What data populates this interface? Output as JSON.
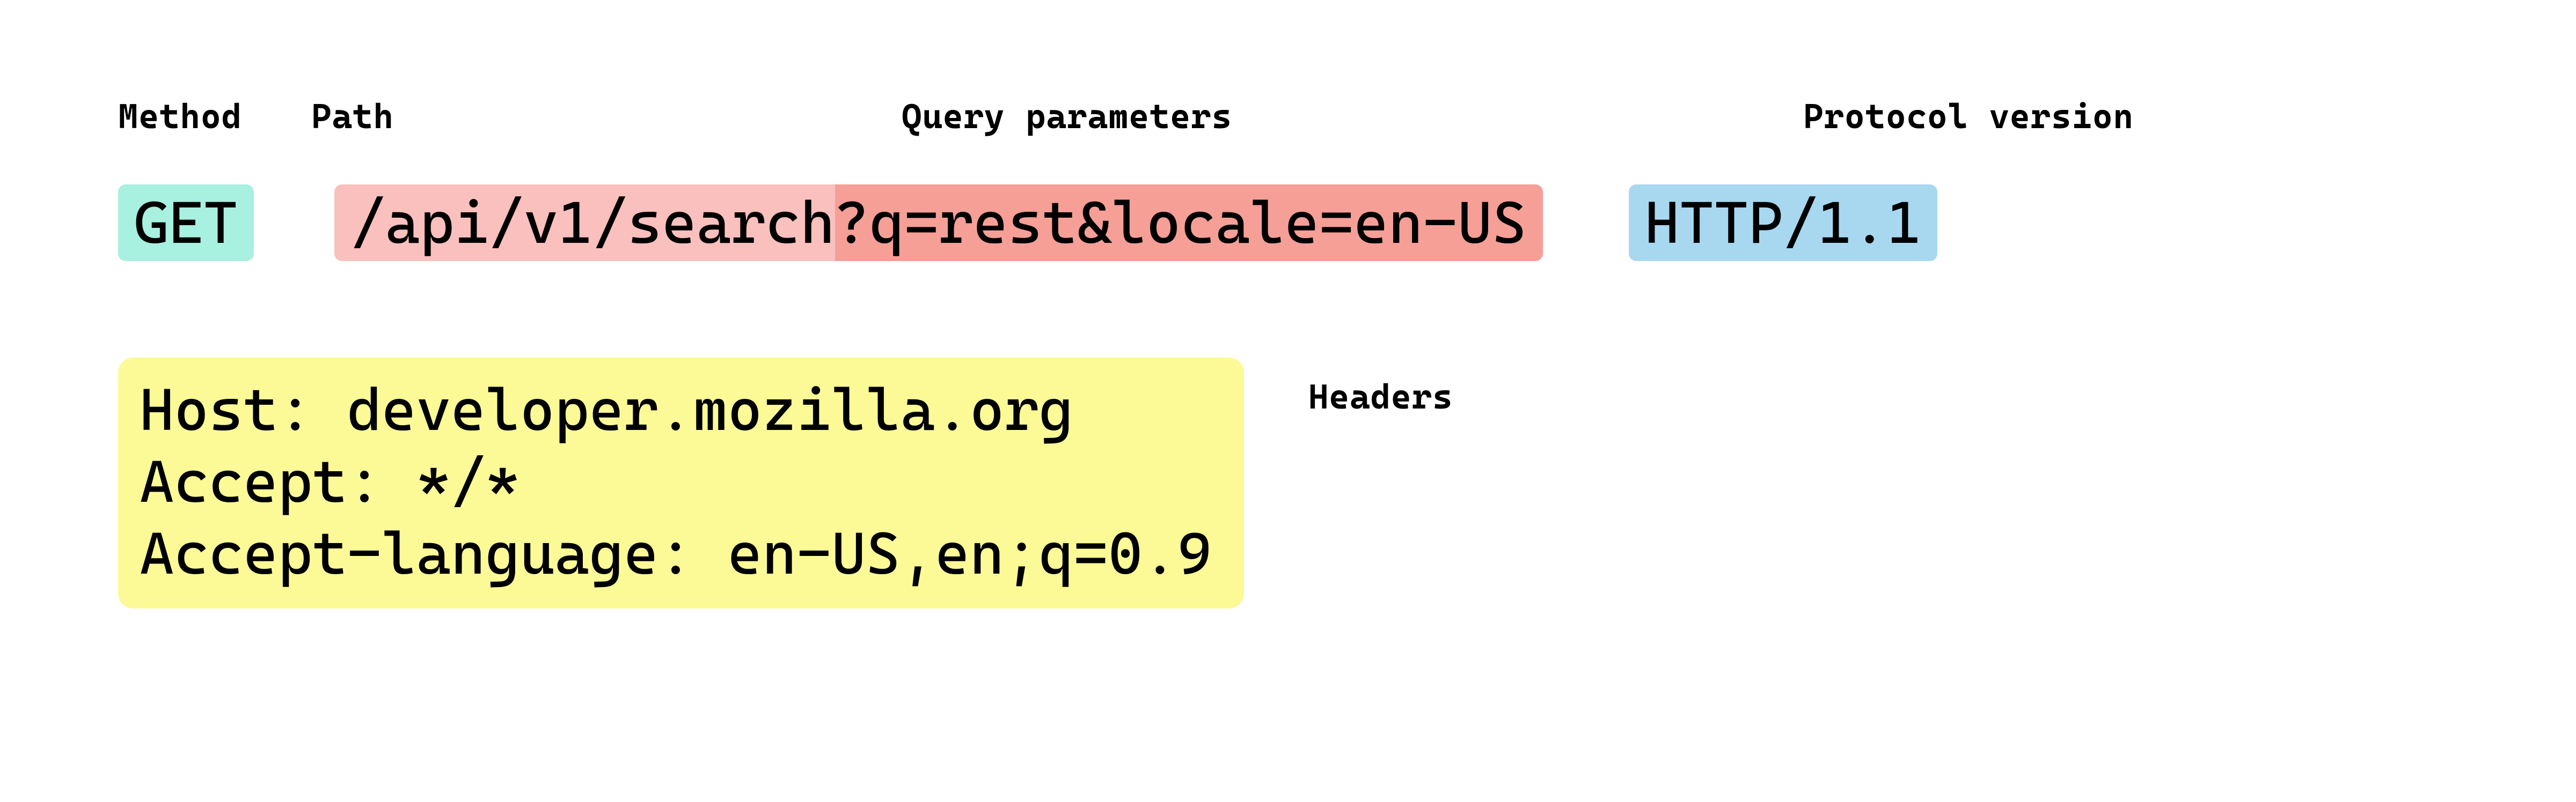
{
  "labels": {
    "method": "Method",
    "path": "Path",
    "query": "Query parameters",
    "protocol": "Protocol version",
    "headers": "Headers"
  },
  "request_line": {
    "method": "GET",
    "path": "/api/v1/search",
    "query": "?q=rest&locale=en-US",
    "protocol": "HTTP/1.1"
  },
  "headers": [
    {
      "name": "Host",
      "value": "developer.mozilla.org"
    },
    {
      "name": "Accept",
      "value": "*/*"
    },
    {
      "name": "Accept-language",
      "value": "en-US,en;q=0.9"
    }
  ],
  "colors": {
    "method_bg": "#a8f0e0",
    "path_bg": "#f9c0bd",
    "query_bg": "#f59f97",
    "protocol_bg": "#a8d8f0",
    "headers_bg": "#fbfa96"
  }
}
